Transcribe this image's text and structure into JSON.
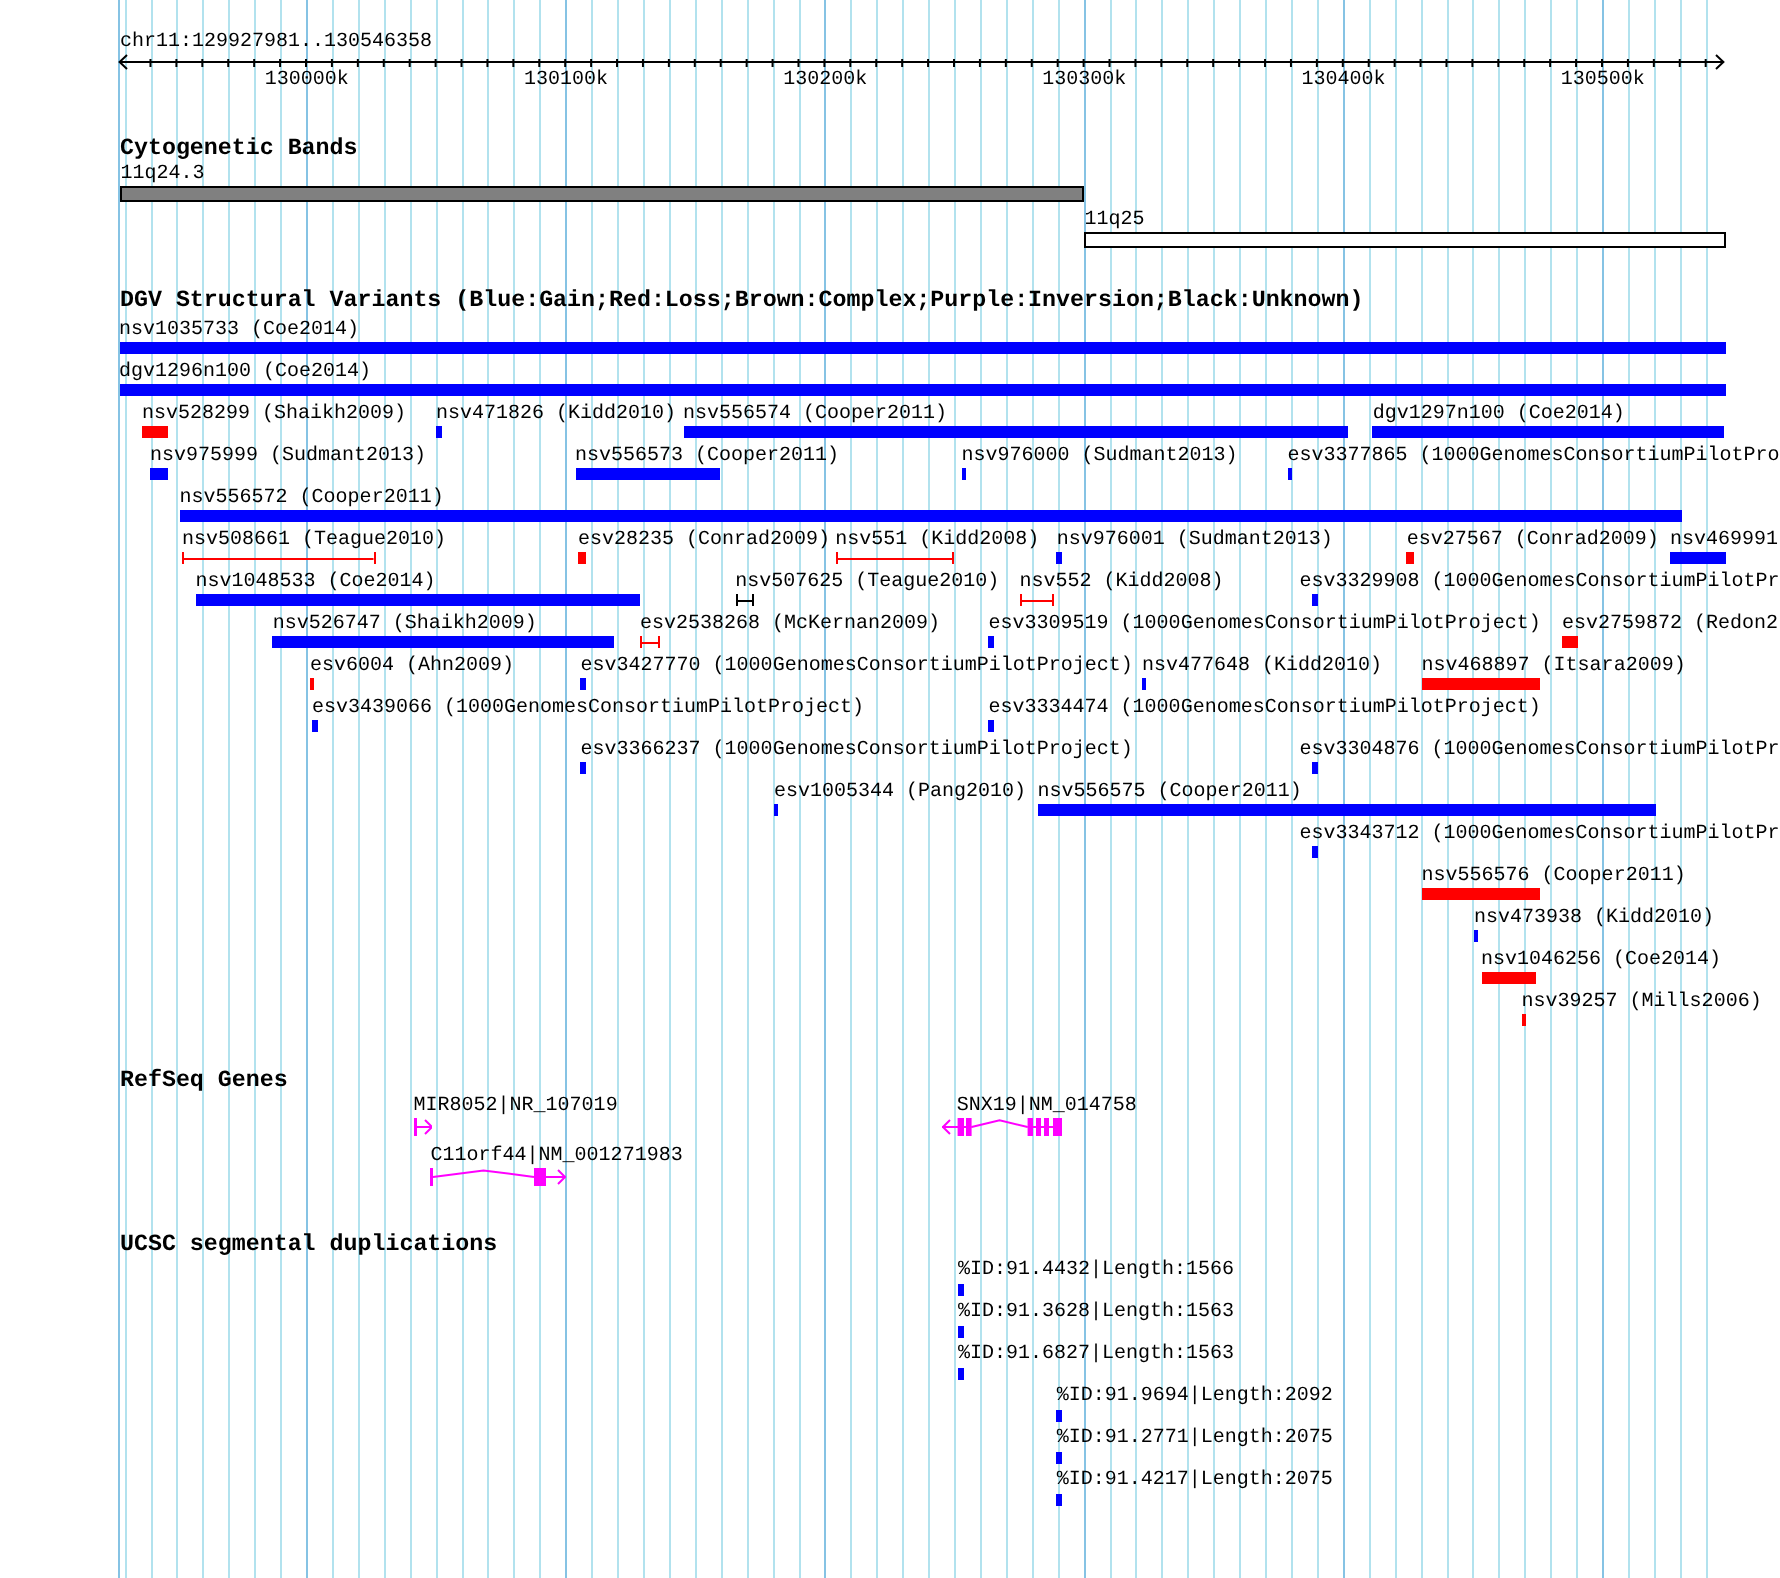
{
  "ruler": {
    "location": "chr11:129927981..130546358",
    "ticks": [
      "130000k",
      "130100k",
      "130200k",
      "130300k",
      "130400k",
      "130500k"
    ]
  },
  "cytogenetic_bands": {
    "title": "Cytogenetic Bands",
    "bands": [
      {
        "label": "11q24.3",
        "color": "#808080"
      },
      {
        "label": "11q25",
        "color": "#ffffff"
      }
    ]
  },
  "dgv_variants": {
    "title": "DGV Structural Variants (Blue:Gain;Red:Loss;Brown:Complex;Purple:Inversion;Black:Unknown)",
    "features": [
      {
        "label": "nsv1035733 (Coe2014)",
        "kind": "bar",
        "color": "#0000ff"
      },
      {
        "label": "dgv1296n100 (Coe2014)",
        "kind": "bar",
        "color": "#0000ff"
      },
      {
        "label": "nsv528299 (Shaikh2009)",
        "kind": "bar",
        "color": "#ff0000"
      },
      {
        "label": "nsv471826 (Kidd2010)",
        "kind": "bar",
        "color": "#0000ff"
      },
      {
        "label": "nsv556574 (Cooper2011)",
        "kind": "bar",
        "color": "#0000ff"
      },
      {
        "label": "dgv1297n100 (Coe2014)",
        "kind": "bar",
        "color": "#0000ff"
      },
      {
        "label": "nsv975999 (Sudmant2013)",
        "kind": "bar",
        "color": "#0000ff"
      },
      {
        "label": "nsv556573 (Cooper2011)",
        "kind": "bar",
        "color": "#0000ff"
      },
      {
        "label": "nsv976000 (Sudmant2013)",
        "kind": "bar",
        "color": "#0000ff"
      },
      {
        "label": "esv3377865 (1000GenomesConsortiumPilotPro",
        "kind": "bar",
        "color": "#0000ff"
      },
      {
        "label": "nsv556572 (Cooper2011)",
        "kind": "bar",
        "color": "#0000ff"
      },
      {
        "label": "nsv508661 (Teague2010)",
        "kind": "span",
        "color": "#ff0000"
      },
      {
        "label": "esv28235 (Conrad2009)",
        "kind": "bar",
        "color": "#ff0000"
      },
      {
        "label": "nsv551 (Kidd2008)",
        "kind": "span",
        "color": "#ff0000"
      },
      {
        "label": "nsv976001 (Sudmant2013)",
        "kind": "bar",
        "color": "#0000ff"
      },
      {
        "label": "esv27567 (Conrad2009)",
        "kind": "bar",
        "color": "#ff0000"
      },
      {
        "label": "nsv469991",
        "kind": "bar",
        "color": "#0000ff"
      },
      {
        "label": "nsv1048533 (Coe2014)",
        "kind": "bar",
        "color": "#0000ff"
      },
      {
        "label": "nsv507625 (Teague2010)",
        "kind": "span",
        "color": "#000000"
      },
      {
        "label": "nsv552 (Kidd2008)",
        "kind": "span",
        "color": "#ff0000"
      },
      {
        "label": "esv3329908 (1000GenomesConsortiumPilotPr",
        "kind": "bar",
        "color": "#0000ff"
      },
      {
        "label": "nsv526747 (Shaikh2009)",
        "kind": "bar",
        "color": "#0000ff"
      },
      {
        "label": "esv2538268 (McKernan2009)",
        "kind": "span",
        "color": "#ff0000"
      },
      {
        "label": "esv3309519 (1000GenomesConsortiumPilotProject)",
        "kind": "bar",
        "color": "#0000ff"
      },
      {
        "label": "esv2759872 (Redon2",
        "kind": "bar",
        "color": "#ff0000"
      },
      {
        "label": "esv6004 (Ahn2009)",
        "kind": "bar",
        "color": "#ff0000"
      },
      {
        "label": "esv3427770 (1000GenomesConsortiumPilotProject)",
        "kind": "bar",
        "color": "#0000ff"
      },
      {
        "label": "nsv477648 (Kidd2010)",
        "kind": "bar",
        "color": "#0000ff"
      },
      {
        "label": "nsv468897 (Itsara2009)",
        "kind": "bar",
        "color": "#ff0000"
      },
      {
        "label": "esv3439066 (1000GenomesConsortiumPilotProject)",
        "kind": "bar",
        "color": "#0000ff"
      },
      {
        "label": "esv3334474 (1000GenomesConsortiumPilotProject)",
        "kind": "bar",
        "color": "#0000ff"
      },
      {
        "label": "esv3366237 (1000GenomesConsortiumPilotProject)",
        "kind": "bar",
        "color": "#0000ff"
      },
      {
        "label": "esv3304876 (1000GenomesConsortiumPilotPr",
        "kind": "bar",
        "color": "#0000ff"
      },
      {
        "label": "esv1005344 (Pang2010)",
        "kind": "bar",
        "color": "#0000ff"
      },
      {
        "label": "nsv556575 (Cooper2011)",
        "kind": "bar",
        "color": "#0000ff"
      },
      {
        "label": "esv3343712 (1000GenomesConsortiumPilotPr",
        "kind": "bar",
        "color": "#0000ff"
      },
      {
        "label": "nsv556576 (Cooper2011)",
        "kind": "bar",
        "color": "#ff0000"
      },
      {
        "label": "nsv473938 (Kidd2010)",
        "kind": "bar",
        "color": "#0000ff"
      },
      {
        "label": "nsv1046256 (Coe2014)",
        "kind": "bar",
        "color": "#ff0000"
      },
      {
        "label": "nsv39257 (Mills2006)",
        "kind": "bar",
        "color": "#ff0000"
      }
    ]
  },
  "refseq_genes": {
    "title": "RefSeq Genes",
    "genes": [
      {
        "label": "MIR8052|NR_107019",
        "kind": "forward"
      },
      {
        "label": "SNX19|NM_014758",
        "kind": "reverse"
      },
      {
        "label": "C11orf44|NM_001271983",
        "kind": "forward"
      }
    ]
  },
  "segmental_duplications": {
    "title": "UCSC segmental duplications",
    "features": [
      {
        "label": "%ID:91.4432|Length:1566"
      },
      {
        "label": "%ID:91.3628|Length:1563"
      },
      {
        "label": "%ID:91.6827|Length:1563"
      },
      {
        "label": "%ID:91.9694|Length:2092"
      },
      {
        "label": "%ID:91.2771|Length:2075"
      },
      {
        "label": "%ID:91.4217|Length:2075"
      }
    ]
  }
}
